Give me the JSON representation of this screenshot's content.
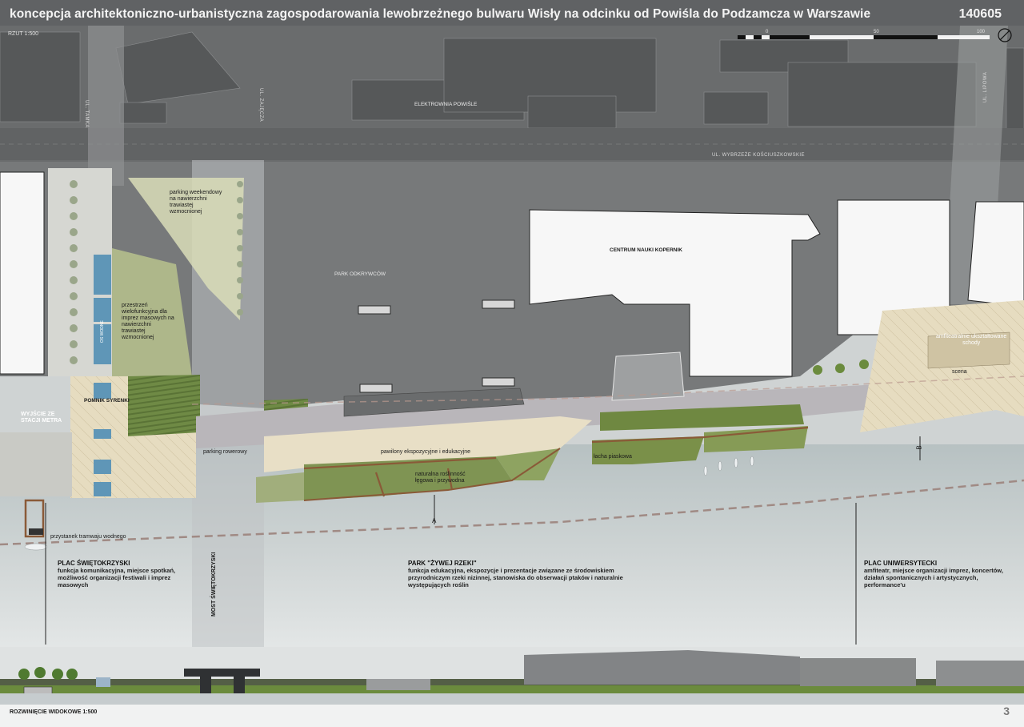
{
  "header": {
    "title": "koncepcja architektoniczno-urbanistyczna zagospodarowania lewobrzeżnego bulwaru Wisły na odcinku od Powiśla do Podzamcza w Warszawie",
    "number": "140605"
  },
  "plan": {
    "scale_label": "RZUT 1:500",
    "scale_bar": [
      "0",
      "50",
      "100"
    ],
    "streets": {
      "tamka": "UL. TAMKA",
      "zajecza": "UL. ZAJĘCZA",
      "wybrzeze": "UL. WYBRZEŻE KOŚCIUSZKOWSKIE",
      "lipowa": "UL. LIPOWA"
    },
    "labels": {
      "elektrownia": "ELEKTROWNIA POWIŚLE",
      "parking_weekend": "parking weekendowy\nna nawierzchni\ntrawiastej\nwzmocnionej",
      "przestrzen": "przestrzeń\nwielofunkcyjna dla\nimprez masowych na\nnawierzchni\ntrawiastej\nwzmocnionej",
      "oczko": "OS WODNE",
      "park_odkrywcow": "PARK ODKRYWCÓW",
      "centrum_nauki": "CENTRUM NAUKI KOPERNIK",
      "amfiteatr": "amfiteatralnie ukształtowane\nschody",
      "scena": "scena",
      "pomnik": "POMNIK SYRENKI",
      "wyjscie": "WYJŚCIE ZE\nSTACJI METRA",
      "parking_rowerowy": "parking rowerowy",
      "pawilony": "pawilony ekspozycyjne i edukacyjne",
      "laka": "łacha piaskowa",
      "roslinnosc": "naturalna roślinność\nłęgowa i przywodna",
      "przystanek": "przystanek tramwaju wodnego",
      "most": "MOST ŚWIĘTOKRZYSKI",
      "section_a": "A",
      "section_b": "B"
    }
  },
  "zones": [
    {
      "title": "PLAC ŚWIĘTOKRZYSKI",
      "desc": "funkcja komunikacyjna, miejsce spotkań,\nmożliwość organizacji festiwali i imprez\nmasowych"
    },
    {
      "title": "PARK \"ŻYWEJ RZEKI\"",
      "desc": "funkcja edukacyjna, ekspozycje i prezentacje związane ze środowiskiem\nprzyrodniczym rzeki nizinnej, stanowiska do obserwacji ptaków i naturalnie\nwystępujących roślin"
    },
    {
      "title": "PLAC UNIWERSYTECKI",
      "desc": "amfiteatr, miejsce organizacji imprez, koncertów,\ndziałań spontanicznych i artystycznych,\nperformance'u"
    }
  ],
  "elevation": {
    "label": "ROZWINIĘCIE WIDOKOWE 1:500",
    "page": "3"
  },
  "colors": {
    "header_bg": "#5f6163",
    "city_gray": "#7b7d7e",
    "building_dark": "#5b5d5e",
    "water": "#c9d1d2",
    "plaza": "#e5d9bd",
    "grass": "#7b8f4e",
    "path": "#a8a4a8",
    "wood": "#8a5a38"
  }
}
